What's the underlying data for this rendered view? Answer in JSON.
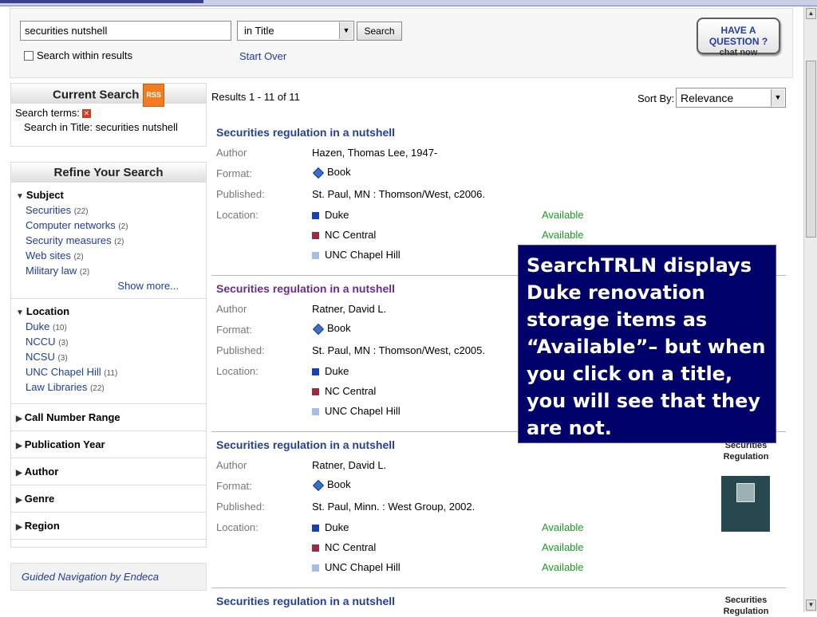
{
  "search": {
    "query": "securities nutshell",
    "field": "in Title",
    "button": "Search",
    "within": "Search within results",
    "start_over": "Start Over",
    "chat_line1": "HAVE A QUESTION ?",
    "chat_line2": "chat now"
  },
  "current": {
    "title": "Current Search",
    "rss": "RSS",
    "terms_label": "Search terms:",
    "remove_icon": "x-icon",
    "term": "Search in Title: securities nutshell"
  },
  "refine": {
    "title": "Refine Your Search",
    "subject": {
      "label": "Subject",
      "items": [
        {
          "label": "Securities",
          "count": "(22)"
        },
        {
          "label": "Computer networks",
          "count": "(2)"
        },
        {
          "label": "Security measures",
          "count": "(2)"
        },
        {
          "label": "Web sites",
          "count": "(2)"
        },
        {
          "label": "Military law",
          "count": "(2)"
        }
      ],
      "show_more": "Show more..."
    },
    "location": {
      "label": "Location",
      "items": [
        {
          "label": "Duke",
          "count": "(10)"
        },
        {
          "label": "NCCU",
          "count": "(3)"
        },
        {
          "label": "NCSU",
          "count": "(3)"
        },
        {
          "label": "UNC Chapel Hill",
          "count": "(11)"
        },
        {
          "label": "Law Libraries",
          "count": "(22)"
        }
      ]
    },
    "collapsed": [
      "Call Number Range",
      "Publication Year",
      "Author",
      "Genre",
      "Region"
    ]
  },
  "guided": "Guided Navigation by Endeca",
  "results": {
    "count": "Results 1 - 11 of 11",
    "sort_label": "Sort By:",
    "sort_value": "Relevance",
    "labels": {
      "author": "Author",
      "format": "Format:",
      "published": "Published:",
      "location": "Location:"
    },
    "available": "Available",
    "locations": [
      "Duke",
      "NC Central",
      "UNC Chapel Hill"
    ],
    "records": [
      {
        "title": "Securities regulation in a nutshell",
        "author": "Hazen, Thomas Lee, 1947-",
        "format": "Book",
        "published": "St. Paul, MN : Thomson/West, c2006."
      },
      {
        "title": "Securities regulation in a nutshell",
        "author": "Ratner, David L.",
        "format": "Book",
        "published": "St. Paul, MN : Thomson/West, c2005."
      },
      {
        "title": "Securities regulation in a nutshell",
        "author": "Ratner, David L.",
        "format": "Book",
        "published": "St. Paul, Minn. : West Group, 2002."
      },
      {
        "title": "Securities regulation in a nutshell"
      }
    ],
    "thumb_text_1": "Securities Regulation",
    "thumb_text_2": "Securities Regulation"
  },
  "callout": "SearchTRLN displays Duke renovation storage items as “Available”– but when you click on a title, you will see that they are not.",
  "colors": {
    "link": "#1f3d9c",
    "available": "#199c20",
    "callout_bg": "#00006a",
    "visited": "#6b2b8f"
  }
}
